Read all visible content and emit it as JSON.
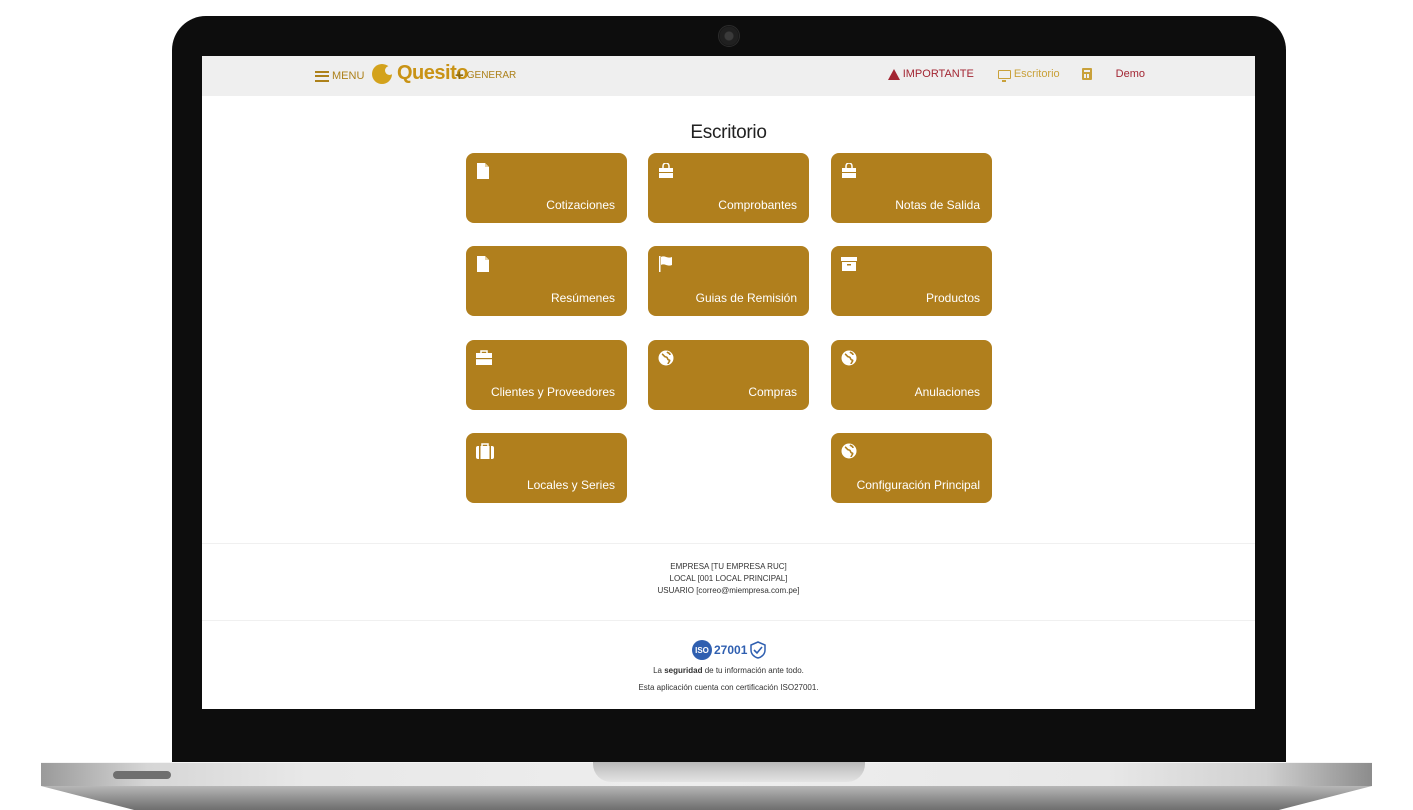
{
  "topbar": {
    "menu_label": "MENU",
    "brand_name": "Quesito",
    "generate_label": "GENERAR",
    "important_label": "IMPORTANTE",
    "desktop_label": "Escritorio",
    "user_label": "Demo"
  },
  "page": {
    "title": "Escritorio"
  },
  "tiles": [
    {
      "label": "Cotizaciones",
      "icon": "file-icon"
    },
    {
      "label": "Comprobantes",
      "icon": "shopping-bag-icon"
    },
    {
      "label": "Notas de Salida",
      "icon": "shopping-bag-icon"
    },
    {
      "label": "Resúmenes",
      "icon": "file-icon"
    },
    {
      "label": "Guias de Remisión",
      "icon": "flag-icon"
    },
    {
      "label": "Productos",
      "icon": "archive-box-icon"
    },
    {
      "label": "Clientes y Proveedores",
      "icon": "briefcase-icon"
    },
    {
      "label": "Compras",
      "icon": "globe-icon"
    },
    {
      "label": "Anulaciones",
      "icon": "globe-icon"
    },
    {
      "label": "Locales y Series",
      "icon": "suitcase-icon"
    },
    {
      "label": "Configuración Principal",
      "icon": "globe-icon"
    }
  ],
  "footer": {
    "empresa": "EMPRESA [TU EMPRESA RUC]",
    "local": "LOCAL [001 LOCAL PRINCIPAL]",
    "usuario": "USUARIO [correo@miempresa.com.pe]",
    "iso_badge": "ISO",
    "iso_number": "27001",
    "security_prefix": "La",
    "security_bold": "seguridad",
    "security_suffix": "de tu información ante todo.",
    "certification": "Esta aplicación cuenta con certificación ISO27001."
  },
  "colors": {
    "tile": "#b07f1d",
    "accent": "#c99315",
    "important": "#a32633",
    "iso": "#2f5fb0"
  }
}
